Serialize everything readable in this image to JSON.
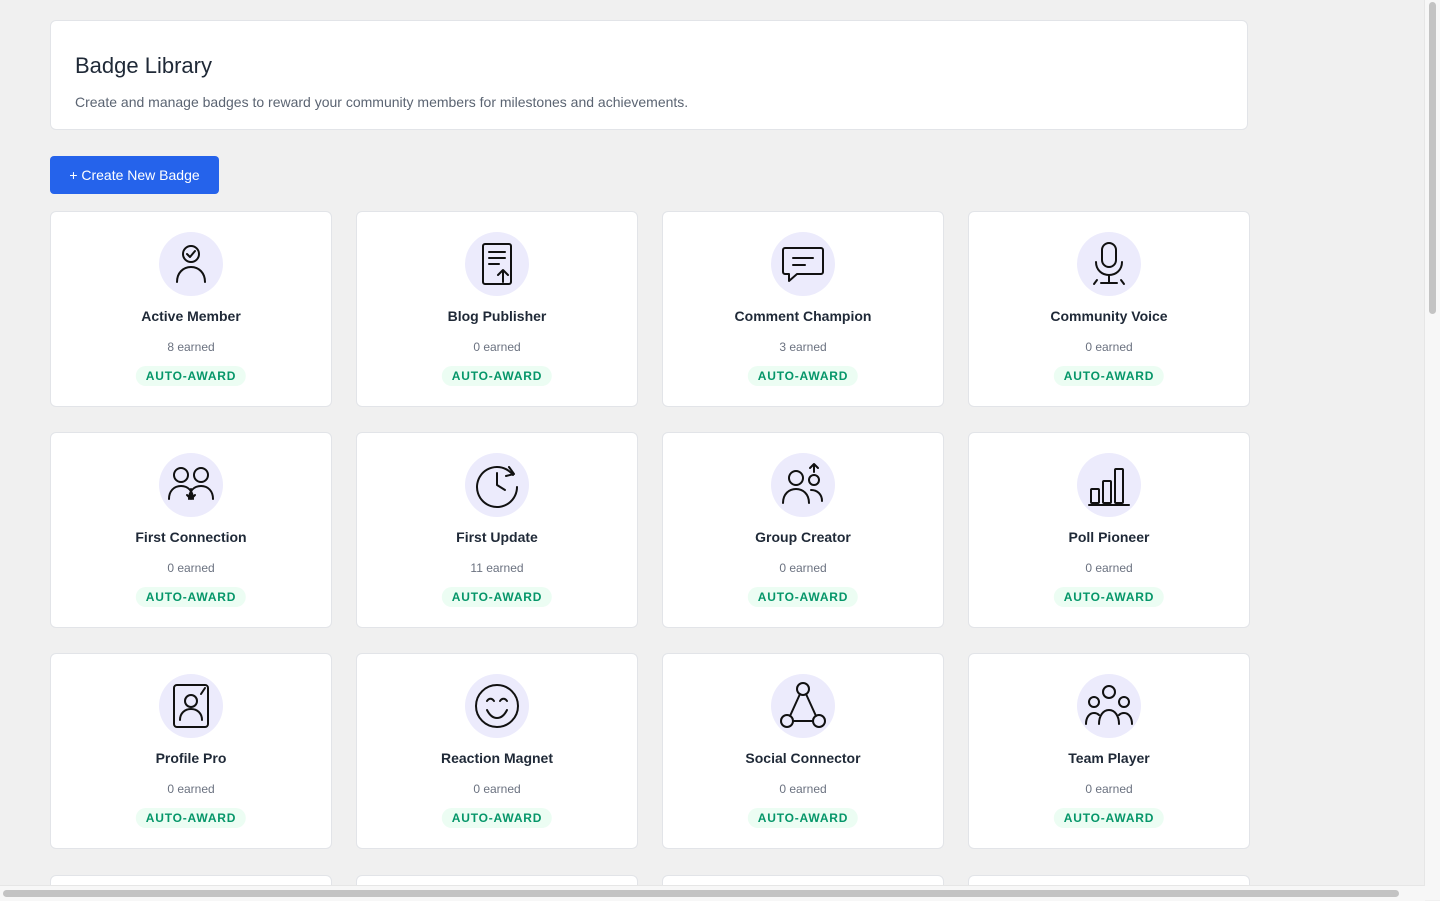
{
  "header": {
    "title": "Badge Library",
    "subtitle": "Create and manage badges to reward your community members for milestones and achievements."
  },
  "toolbar": {
    "create_label": "+ Create New Badge"
  },
  "colors": {
    "accent": "#2563eb",
    "icon_bg": "#ecebfc",
    "tag_text": "#059669",
    "tag_bg": "#ecfdf3"
  },
  "badges": [
    {
      "name": "Active Member",
      "earned": "8 earned",
      "tag": "AUTO-AWARD",
      "icon": "user-check-icon"
    },
    {
      "name": "Blog Publisher",
      "earned": "0 earned",
      "tag": "AUTO-AWARD",
      "icon": "document-upload-icon"
    },
    {
      "name": "Comment Champion",
      "earned": "3 earned",
      "tag": "AUTO-AWARD",
      "icon": "chat-bubble-icon"
    },
    {
      "name": "Community Voice",
      "earned": "0 earned",
      "tag": "AUTO-AWARD",
      "icon": "microphone-icon"
    },
    {
      "name": "First Connection",
      "earned": "0 earned",
      "tag": "AUTO-AWARD",
      "icon": "users-connect-icon"
    },
    {
      "name": "First Update",
      "earned": "11 earned",
      "tag": "AUTO-AWARD",
      "icon": "clock-refresh-icon"
    },
    {
      "name": "Group Creator",
      "earned": "0 earned",
      "tag": "AUTO-AWARD",
      "icon": "group-add-icon"
    },
    {
      "name": "Poll Pioneer",
      "earned": "0 earned",
      "tag": "AUTO-AWARD",
      "icon": "bar-chart-icon"
    },
    {
      "name": "Profile Pro",
      "earned": "0 earned",
      "tag": "AUTO-AWARD",
      "icon": "profile-card-icon"
    },
    {
      "name": "Reaction Magnet",
      "earned": "0 earned",
      "tag": "AUTO-AWARD",
      "icon": "smiley-icon"
    },
    {
      "name": "Social Connector",
      "earned": "0 earned",
      "tag": "AUTO-AWARD",
      "icon": "network-icon"
    },
    {
      "name": "Team Player",
      "earned": "0 earned",
      "tag": "AUTO-AWARD",
      "icon": "team-icon"
    }
  ]
}
